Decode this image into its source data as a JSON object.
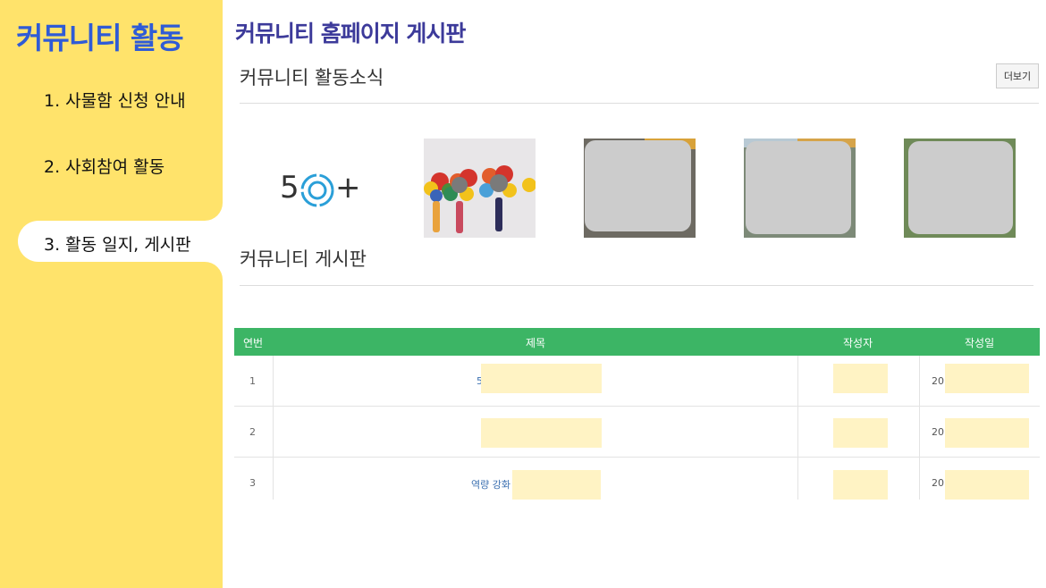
{
  "sidebar": {
    "title": "커뮤니티 활동",
    "items": [
      {
        "label": "1. 사물함 신청 안내",
        "active": false
      },
      {
        "label": "2. 사회참여 활동",
        "active": false
      },
      {
        "label": "3. 활동 일지, 게시판",
        "active": true
      }
    ]
  },
  "main": {
    "page_title": "커뮤니티 홈페이지 게시판",
    "news_section": {
      "heading": "커뮤니티 활동소식",
      "more_label": "더보기",
      "logo_text_left": "5",
      "logo_text_right": "+"
    },
    "board_section": {
      "heading": "커뮤니티 게시판",
      "columns": [
        "연번",
        "제목",
        "작성자",
        "작성일"
      ],
      "rows": [
        {
          "num": "1",
          "title": "5",
          "author": "",
          "date": "20:"
        },
        {
          "num": "2",
          "title": "",
          "author": "",
          "date": "20:"
        },
        {
          "num": "3",
          "title": "역량 강화 ",
          "author": "",
          "date": "20:"
        }
      ]
    }
  },
  "colors": {
    "sidebar_bg": "#ffe36b",
    "sidebar_title": "#2f5bd6",
    "page_title": "#3c3a9a",
    "table_header": "#3cb565",
    "redaction": "#fff3c4"
  }
}
